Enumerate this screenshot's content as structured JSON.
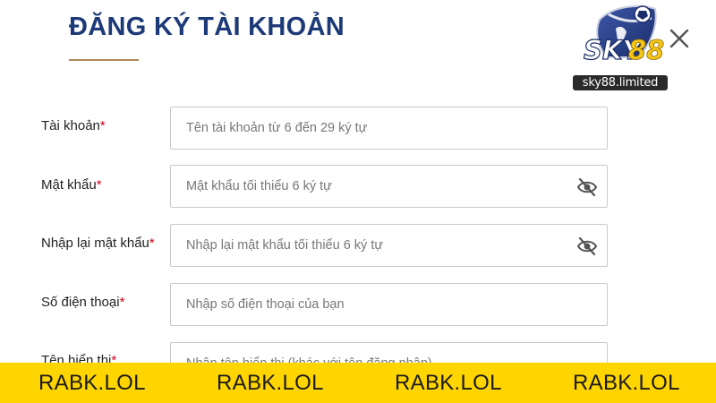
{
  "page": {
    "title": "ĐĂNG KÝ TÀI KHOẢN",
    "accent_color": "#1d3a78",
    "underline_color": "#b08a5a"
  },
  "logo": {
    "wordmark": "SKY88",
    "caption": "sky88.limited"
  },
  "close_icon": "close-icon",
  "form": {
    "fields": [
      {
        "label": "Tài khoản",
        "required_mark": "*",
        "placeholder": "Tên tài khoản từ 6 đến 29 ký tự",
        "value": ""
      },
      {
        "label": "Mật khẩu",
        "required_mark": "*",
        "placeholder": "Mật khẩu tối thiểu 6 ký tự",
        "value": "",
        "icon": "eye-slash-icon"
      },
      {
        "label": "Nhập lại mật khẩu",
        "required_mark": "*",
        "placeholder": "Nhập lại mật khẩu tối thiểu 6 ký tự",
        "value": "",
        "icon": "eye-slash-icon"
      },
      {
        "label": "Số điện thoại",
        "required_mark": "*",
        "placeholder": "Nhập số điện thoại của bạn",
        "value": ""
      },
      {
        "label": "Tên hiển thị",
        "required_mark": "*",
        "placeholder": "Nhập tên hiển thị (khác với tên đăng nhập)",
        "value": ""
      }
    ]
  },
  "watermark_banner": {
    "background": "#ffd500",
    "texts": [
      "RABK.LOL",
      "RABK.LOL",
      "RABK.LOL",
      "RABK.LOL"
    ]
  }
}
